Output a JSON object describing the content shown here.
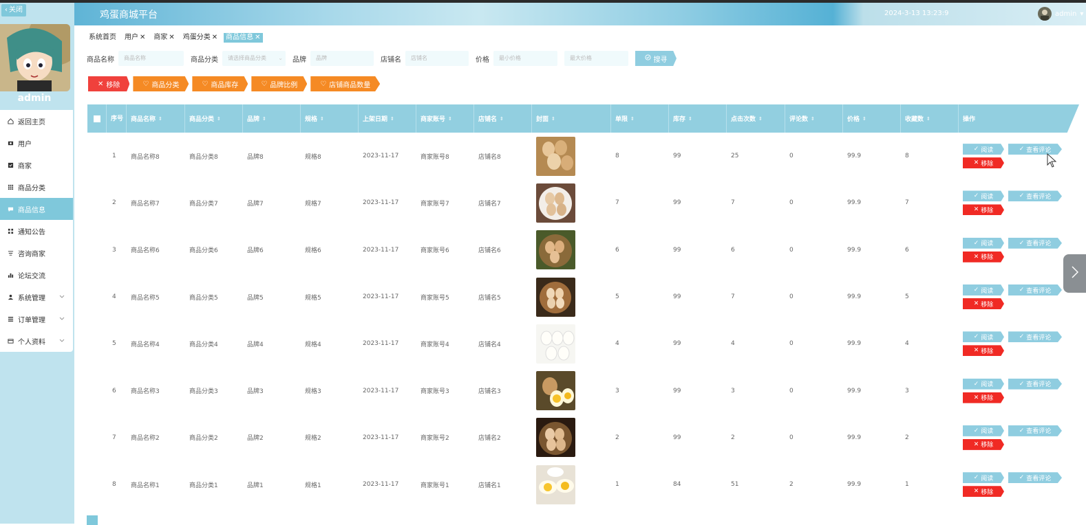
{
  "header": {
    "title": "鸡蛋商城平台",
    "datetime": "2024-3-13 13:23:9",
    "username": "admin"
  },
  "sidebar": {
    "close_label": "关闭",
    "username": "admin",
    "items": [
      {
        "label": "返回主页",
        "icon": "home-icon"
      },
      {
        "label": "用户",
        "icon": "user-icon"
      },
      {
        "label": "商家",
        "icon": "shop-icon"
      },
      {
        "label": "商品分类",
        "icon": "grid-icon"
      },
      {
        "label": "商品信息",
        "icon": "chat-icon",
        "active": true
      },
      {
        "label": "通知公告",
        "icon": "apps-icon"
      },
      {
        "label": "咨询商家",
        "icon": "filter-icon"
      },
      {
        "label": "论坛交流",
        "icon": "bar-chart-icon"
      },
      {
        "label": "系统管理",
        "icon": "person-icon",
        "expandable": true
      },
      {
        "label": "订单管理",
        "icon": "list-icon",
        "expandable": true
      },
      {
        "label": "个人资料",
        "icon": "card-icon",
        "expandable": true
      }
    ]
  },
  "tabs": [
    {
      "label": "系统首页",
      "closable": false
    },
    {
      "label": "用户",
      "closable": true
    },
    {
      "label": "商家",
      "closable": true
    },
    {
      "label": "鸡蛋分类",
      "closable": true
    },
    {
      "label": "商品信息",
      "closable": true,
      "active": true
    }
  ],
  "search": {
    "name_label": "商品名称",
    "name_placeholder": "商品名称",
    "category_label": "商品分类",
    "category_placeholder": "请选择商品分类",
    "brand_label": "品牌",
    "brand_placeholder": "品牌",
    "store_label": "店铺名",
    "store_placeholder": "店铺名",
    "price_label": "价格",
    "min_price_placeholder": "最小价格",
    "max_price_placeholder": "最大价格",
    "button_label": "搜寻"
  },
  "actions": [
    "移除",
    "商品分类",
    "商品库存",
    "品牌比例",
    "店铺商品数量"
  ],
  "table": {
    "columns": [
      "序号",
      "商品名称",
      "商品分类",
      "品牌",
      "规格",
      "上架日期",
      "商家账号",
      "店铺名",
      "封面",
      "单限",
      "库存",
      "点击次数",
      "评论数",
      "价格",
      "收藏数",
      "操作"
    ],
    "rows": [
      {
        "idx": "1",
        "name": "商品名称8",
        "category": "商品分类8",
        "brand": "品牌8",
        "spec": "规格8",
        "date": "2023-11-17",
        "merchant": "商家账号8",
        "store": "店铺名8",
        "limit": "8",
        "stock": "99",
        "clicks": "25",
        "comments": "0",
        "price": "99.9",
        "favs": "8"
      },
      {
        "idx": "2",
        "name": "商品名称7",
        "category": "商品分类7",
        "brand": "品牌7",
        "spec": "规格7",
        "date": "2023-11-17",
        "merchant": "商家账号7",
        "store": "店铺名7",
        "limit": "7",
        "stock": "99",
        "clicks": "7",
        "comments": "0",
        "price": "99.9",
        "favs": "7"
      },
      {
        "idx": "3",
        "name": "商品名称6",
        "category": "商品分类6",
        "brand": "品牌6",
        "spec": "规格6",
        "date": "2023-11-17",
        "merchant": "商家账号6",
        "store": "店铺名6",
        "limit": "6",
        "stock": "99",
        "clicks": "6",
        "comments": "0",
        "price": "99.9",
        "favs": "6"
      },
      {
        "idx": "4",
        "name": "商品名称5",
        "category": "商品分类5",
        "brand": "品牌5",
        "spec": "规格5",
        "date": "2023-11-17",
        "merchant": "商家账号5",
        "store": "店铺名5",
        "limit": "5",
        "stock": "99",
        "clicks": "7",
        "comments": "0",
        "price": "99.9",
        "favs": "5"
      },
      {
        "idx": "5",
        "name": "商品名称4",
        "category": "商品分类4",
        "brand": "品牌4",
        "spec": "规格4",
        "date": "2023-11-17",
        "merchant": "商家账号4",
        "store": "店铺名4",
        "limit": "4",
        "stock": "99",
        "clicks": "4",
        "comments": "0",
        "price": "99.9",
        "favs": "4"
      },
      {
        "idx": "6",
        "name": "商品名称3",
        "category": "商品分类3",
        "brand": "品牌3",
        "spec": "规格3",
        "date": "2023-11-17",
        "merchant": "商家账号3",
        "store": "店铺名3",
        "limit": "3",
        "stock": "99",
        "clicks": "3",
        "comments": "0",
        "price": "99.9",
        "favs": "3"
      },
      {
        "idx": "7",
        "name": "商品名称2",
        "category": "商品分类2",
        "brand": "品牌2",
        "spec": "规格2",
        "date": "2023-11-17",
        "merchant": "商家账号2",
        "store": "店铺名2",
        "limit": "2",
        "stock": "99",
        "clicks": "2",
        "comments": "0",
        "price": "99.9",
        "favs": "2"
      },
      {
        "idx": "8",
        "name": "商品名称1",
        "category": "商品分类1",
        "brand": "品牌1",
        "spec": "规格1",
        "date": "2023-11-17",
        "merchant": "商家账号1",
        "store": "店铺名1",
        "limit": "1",
        "stock": "84",
        "clicks": "51",
        "comments": "2",
        "price": "99.9",
        "favs": "1"
      }
    ],
    "op_read": "阅读",
    "op_comment": "查看评论",
    "op_delete": "移除"
  },
  "colors": {
    "accent": "#7fc8db",
    "danger": "#f0413c",
    "warning": "#f58a24",
    "sidebar_bg": "#bfe3ee"
  }
}
